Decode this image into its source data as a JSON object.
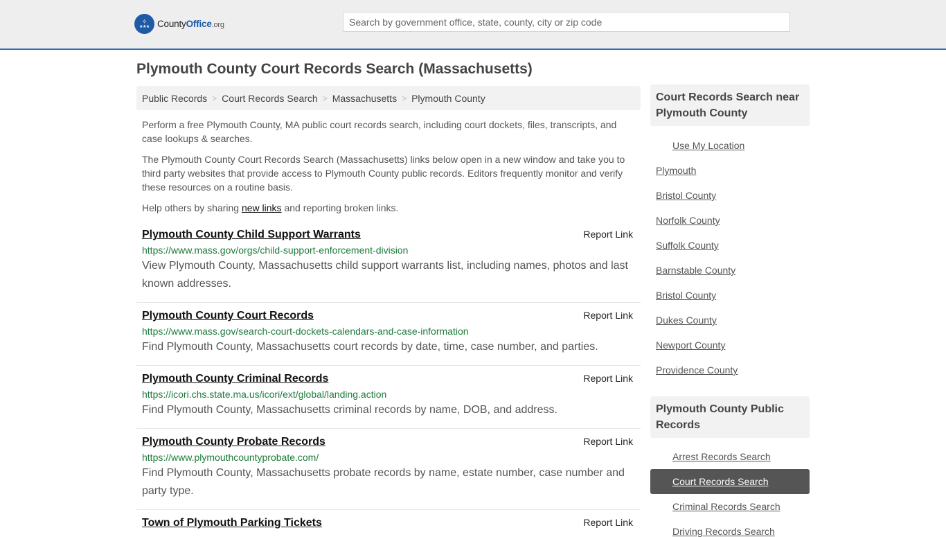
{
  "header": {
    "logo": {
      "name_part1": "County",
      "name_part2": "Office",
      "tld": ".org"
    },
    "search_placeholder": "Search by government office, state, county, city or zip code",
    "accent_color": "#2f6fb5"
  },
  "page_title": "Plymouth County Court Records Search (Massachusetts)",
  "breadcrumb": [
    "Public Records",
    "Court Records Search",
    "Massachusetts",
    "Plymouth County"
  ],
  "intro": {
    "p1": "Perform a free Plymouth County, MA public court records search, including court dockets, files, transcripts, and case lookups & searches.",
    "p2": "The Plymouth County Court Records Search (Massachusetts) links below open in a new window and take you to third party websites that provide access to Plymouth County public records. Editors frequently monitor and verify these resources on a routine basis.",
    "p3_before": "Help others by sharing ",
    "p3_link": "new links",
    "p3_after": " and reporting broken links."
  },
  "listings": [
    {
      "title": "Plymouth County Child Support Warrants",
      "report": "Report Link",
      "url": "https://www.mass.gov/orgs/child-support-enforcement-division",
      "desc": "View Plymouth County, Massachusetts child support warrants list, including names, photos and last known addresses."
    },
    {
      "title": "Plymouth County Court Records",
      "report": "Report Link",
      "url": "https://www.mass.gov/search-court-dockets-calendars-and-case-information",
      "desc": "Find Plymouth County, Massachusetts court records by date, time, case number, and parties."
    },
    {
      "title": "Plymouth County Criminal Records",
      "report": "Report Link",
      "url": "https://icori.chs.state.ma.us/icori/ext/global/landing.action",
      "desc": "Find Plymouth County, Massachusetts criminal records by name, DOB, and address."
    },
    {
      "title": "Plymouth County Probate Records",
      "report": "Report Link",
      "url": "https://www.plymouthcountyprobate.com/",
      "desc": "Find Plymouth County, Massachusetts probate records by name, estate number, case number and party type."
    },
    {
      "title": "Town of Plymouth Parking Tickets",
      "report": "Report Link"
    }
  ],
  "sidebar": {
    "nearby": {
      "heading": "Court Records Search near Plymouth County",
      "use_location": "Use My Location",
      "links": [
        "Plymouth",
        "Bristol County",
        "Norfolk County",
        "Suffolk County",
        "Barnstable County",
        "Bristol County",
        "Dukes County",
        "Newport County",
        "Providence County"
      ]
    },
    "public_records": {
      "heading": "Plymouth County Public Records",
      "links": [
        "Arrest Records Search",
        "Court Records Search",
        "Criminal Records Search",
        "Driving Records Search"
      ],
      "active_index": 1
    }
  }
}
